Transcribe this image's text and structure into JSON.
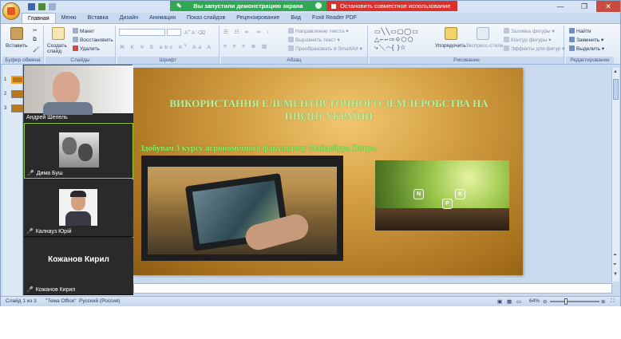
{
  "share": {
    "status_text": "Вы запустили демонстрацию экрана",
    "stop_label": "Остановить совместное использование"
  },
  "tabs": [
    "Главная",
    "Меню",
    "Вставка",
    "Дизайн",
    "Анимация",
    "Показ слайдов",
    "Рецензирование",
    "Вид",
    "Foxit Reader PDF"
  ],
  "ribbon": {
    "clipboard": {
      "paste": "Вставить",
      "label": "Буфер обмена"
    },
    "slides": {
      "new_slide": "Создать слайд",
      "layout": "Макет",
      "reset": "Восстановить",
      "delete": "Удалить",
      "label": "Слайды"
    },
    "font": {
      "label": "Шрифт"
    },
    "paragraph": {
      "text_direction": "Направление текста",
      "align_text": "Выровнять текст",
      "smartart": "Преобразовать в SmartArt",
      "label": "Абзац"
    },
    "drawing": {
      "arrange": "Упорядочить",
      "quick_styles": "Экспресс-стили",
      "fill": "Заливка фигуры",
      "outline": "Контур фигуры",
      "effects": "Эффекты для фигур",
      "label": "Рисование"
    },
    "editing": {
      "find": "Найти",
      "replace": "Заменить",
      "select": "Выделить",
      "label": "Редактирование"
    }
  },
  "slide": {
    "title": "ВИКОРИСТАННЯ ЕЛЕМЕНТІВ ТОЧНОГО ЗЕМЛЕРОБСТВА НА ПІВДНІ УКРАЇНИ",
    "subtitle": "Здобувач 3 курсу агрономічного факультету Майдебура Петро.",
    "nutrients": [
      "N",
      "P",
      "K"
    ]
  },
  "participants": [
    {
      "name": "Андрей Шепель",
      "muted": false
    },
    {
      "name": "Дима Буш",
      "muted": true
    },
    {
      "name": "Калнауз Юрій",
      "muted": true
    },
    {
      "name": "Кожанов Кирил",
      "muted": true,
      "display": "Кожанов Кирил"
    }
  ],
  "thumbs": [
    "1",
    "2",
    "3"
  ],
  "status": {
    "slide": "Слайд 1 из 3",
    "theme": "\"Тема Office\"",
    "language": "Русский (Россия)",
    "zoom": "64%"
  },
  "colors": {
    "share_green": "#33a852",
    "share_red": "#d9312c",
    "slide_title": "#b8f0a8"
  }
}
